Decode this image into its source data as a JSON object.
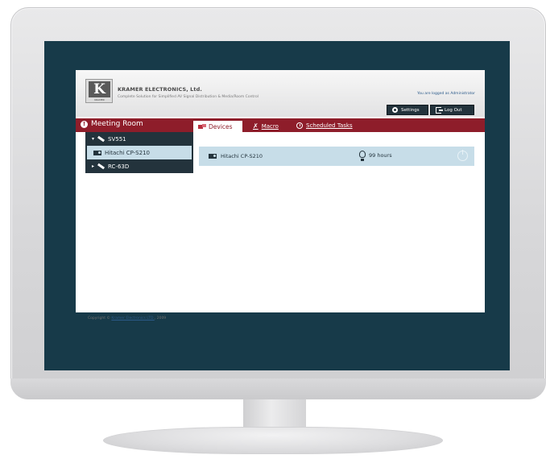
{
  "header": {
    "logo_text": "K",
    "logo_sub": "KRAMER",
    "company_name": "KRAMER ELECTRONICS, Ltd.",
    "tagline": "Complete Solution for Simplified AV Signal Distribution & Media/Room Control",
    "logged_as": "You are logged as Administrator",
    "settings_label": "Settings",
    "logout_label": "Log Out"
  },
  "nav": {
    "room_title": "Meeting Room",
    "tabs": [
      {
        "label": "Devices",
        "icon": "devices-icon",
        "active": true
      },
      {
        "label": "Macro",
        "icon": "macro-icon",
        "active": false
      },
      {
        "label": "Scheduled Tasks",
        "icon": "clock-icon",
        "active": false
      }
    ]
  },
  "tree": {
    "items": [
      {
        "label": "SV551",
        "expand": "▾",
        "icon": "wand-icon"
      },
      {
        "label": "Hitachi CP-S210",
        "icon": "projector-icon"
      },
      {
        "label": "RC-63D",
        "expand": "▸",
        "icon": "wand-icon"
      }
    ]
  },
  "device_row": {
    "name": "Hitachi CP-S210",
    "hours": "99 hours"
  },
  "footer": {
    "copyright_prefix": "Copyright ©",
    "company_link": "Kramer Electronics LTD.",
    "year": "2009"
  },
  "colors": {
    "accent": "#8e1d2a",
    "dark": "#23333c",
    "highlight": "#c7dde8",
    "screen_bg": "#173a49"
  }
}
